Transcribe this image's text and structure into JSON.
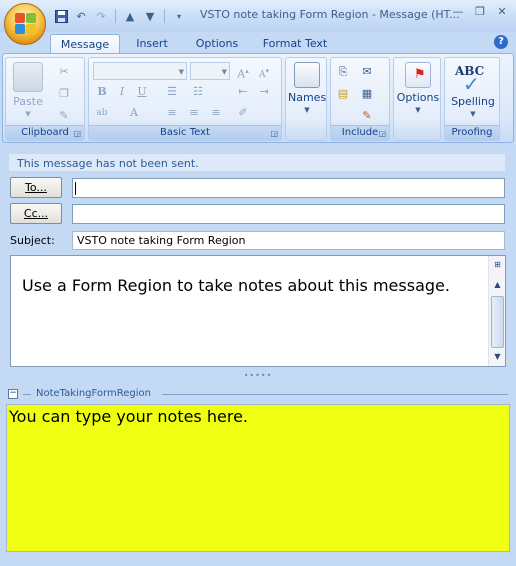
{
  "window": {
    "title": "VSTO note taking Form Region - Message (HT...",
    "controls": [
      "minimize-icon",
      "restore-icon",
      "close-icon"
    ]
  },
  "quick_access": [
    "save-icon",
    "undo-icon",
    "redo-icon",
    "up-icon",
    "down-icon",
    "customize-icon"
  ],
  "tabs": [
    {
      "label": "Message",
      "active": true
    },
    {
      "label": "Insert",
      "active": false
    },
    {
      "label": "Options",
      "active": false
    },
    {
      "label": "Format Text",
      "active": false
    }
  ],
  "ribbon": {
    "clipboard": {
      "label": "Clipboard",
      "paste": "Paste"
    },
    "basic_text": {
      "label": "Basic Text",
      "bold": "B",
      "italic": "I",
      "underline": "U"
    },
    "names": {
      "label": "Names"
    },
    "include": {
      "label": "Include"
    },
    "options": {
      "label": "Options"
    },
    "proofing": {
      "label": "Proofing",
      "spelling": "Spelling",
      "abc": "ABC"
    }
  },
  "message": {
    "info": "This message has not been sent.",
    "to_label": "To...",
    "cc_label": "Cc...",
    "subject_label": "Subject:",
    "subject": "VSTO note taking Form Region",
    "body": "Use a Form Region to take notes about this message."
  },
  "form_region": {
    "title": "NoteTakingFormRegion",
    "notes": "You can type your notes here."
  },
  "colors": {
    "notes_background": "#f0ff12",
    "ribbon_text": "#15428b"
  }
}
